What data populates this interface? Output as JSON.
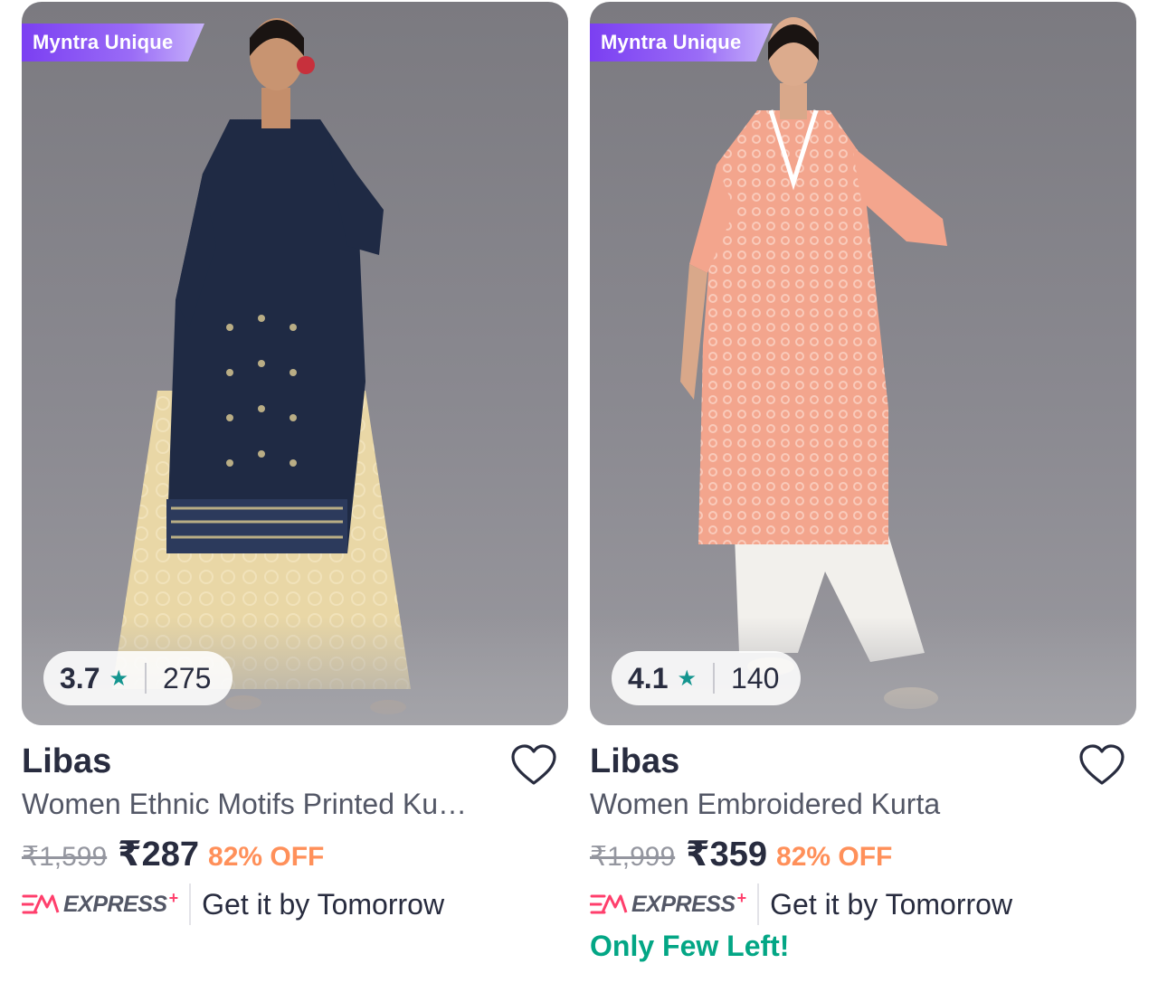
{
  "colors": {
    "tag_purple": "#7b3ff2",
    "rating_star": "#14958f",
    "discount": "#ff905a",
    "stock_green": "#03a685",
    "express_pink": "#ff3f6c",
    "brand_text": "#282c3f"
  },
  "products": [
    {
      "tag": "Myntra Unique",
      "rating": "3.7",
      "rating_icon": "star-icon",
      "rating_count": "275",
      "brand": "Libas",
      "title": "Women Ethnic Motifs Printed Kurta with Skirt",
      "mrp": "₹1,599",
      "price": "₹287",
      "discount": "82% OFF",
      "express_label": "EXPRESS",
      "express_plus": "+",
      "delivery": "Get it by Tomorrow",
      "stock_note": ""
    },
    {
      "tag": "Myntra Unique",
      "rating": "4.1",
      "rating_icon": "star-icon",
      "rating_count": "140",
      "brand": "Libas",
      "title": "Women Embroidered Kurta",
      "mrp": "₹1,999",
      "price": "₹359",
      "discount": "82% OFF",
      "express_label": "EXPRESS",
      "express_plus": "+",
      "delivery": "Get it by Tomorrow",
      "stock_note": "Only Few Left!"
    }
  ]
}
